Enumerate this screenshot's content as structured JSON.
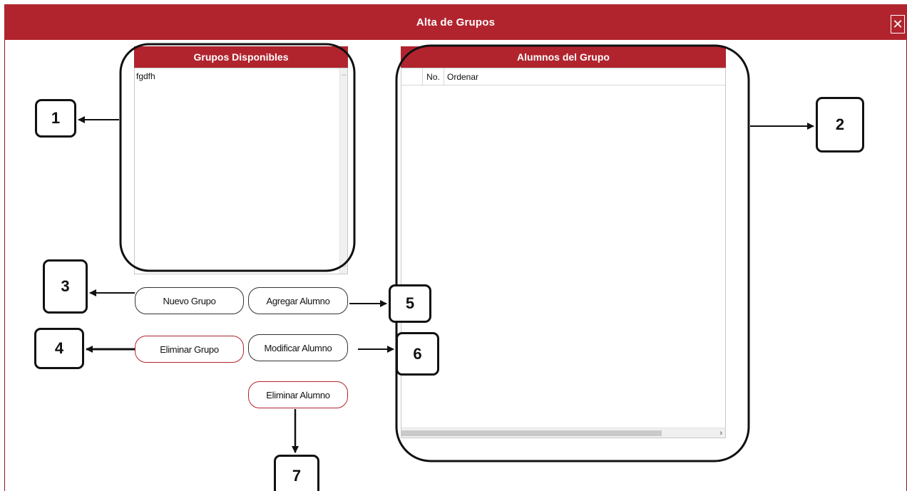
{
  "window": {
    "title": "Alta de Grupos",
    "close_symbol": "✕"
  },
  "groups_panel": {
    "header": "Grupos Disponibles",
    "items": [
      "fgdfh"
    ]
  },
  "students_panel": {
    "header": "Alumnos del Grupo",
    "columns": [
      "No.",
      "Ordenar"
    ]
  },
  "buttons": {
    "nuevo_grupo": "Nuevo Grupo",
    "agregar_alumno": "Agregar Alumno",
    "eliminar_grupo": "Eliminar Grupo",
    "modificar_alumno": "Modificar Alumno",
    "eliminar_alumno": "Eliminar Alumno"
  },
  "callouts": [
    "1",
    "2",
    "3",
    "4",
    "5",
    "6",
    "7"
  ],
  "colors": {
    "accent": "#b1242e",
    "annotation": "#111111"
  }
}
